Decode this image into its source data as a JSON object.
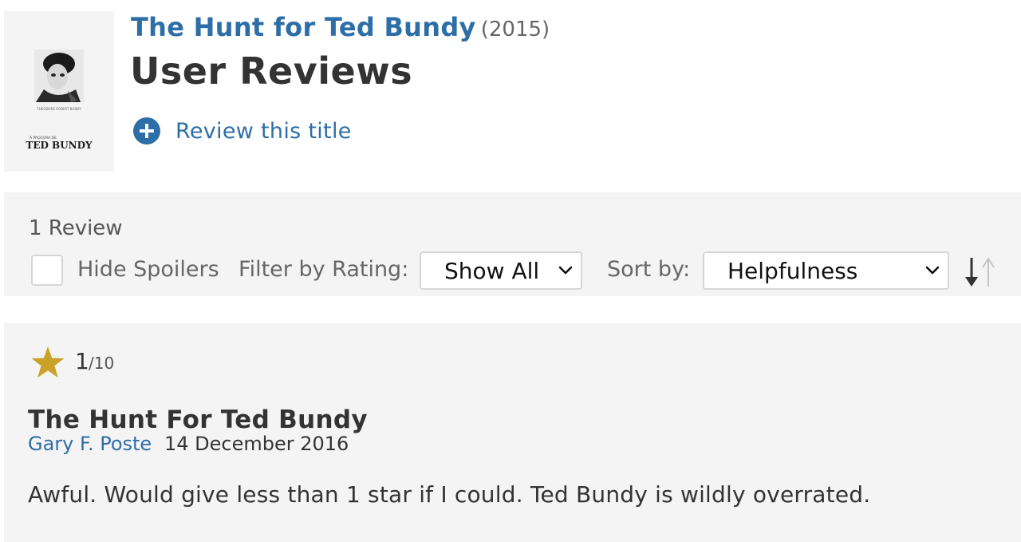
{
  "header": {
    "movie_title": "The Hunt for Ted Bundy",
    "year": "(2015)",
    "page_title": "User Reviews",
    "review_link_label": "Review this title",
    "poster": {
      "caption_small": "THEODORE ROBERT BUNDY",
      "caption_sub": "À PROCURA DE",
      "caption_main": "TED BUNDY"
    }
  },
  "filters": {
    "review_count": "1 Review",
    "hide_spoilers_label": "Hide Spoilers",
    "hide_spoilers_checked": false,
    "filter_label": "Filter by Rating:",
    "filter_value": "Show All",
    "sort_label": "Sort by:",
    "sort_value": "Helpfulness"
  },
  "review": {
    "rating": "1",
    "scale": "/10",
    "title": "The Hunt For Ted Bundy",
    "author": "Gary F. Poste",
    "date": "14 December 2016",
    "text": "Awful. Would give less than 1 star if I could. Ted Bundy is wildly overrated."
  },
  "colors": {
    "link": "#2d6ea8",
    "star": "#c9a227",
    "panel_bg": "#f4f4f4"
  },
  "icons": {
    "add": "plus-circle-icon",
    "star": "star-icon",
    "chevron": "chevron-down-icon",
    "sort": "sort-direction-icon"
  }
}
